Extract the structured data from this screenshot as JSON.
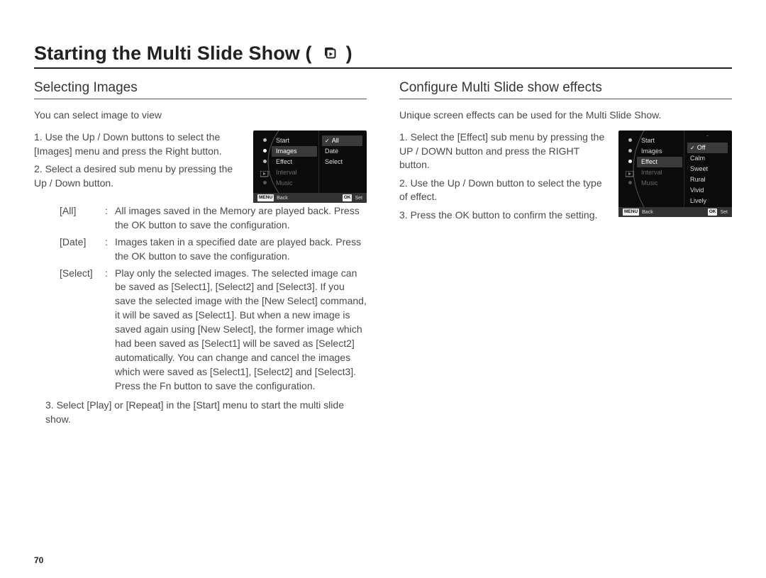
{
  "title": {
    "text_before": "Starting the Multi Slide Show (",
    "text_after": ")"
  },
  "page_number": "70",
  "left": {
    "heading": "Selecting Images",
    "lead": "You can select image to view",
    "step1": "1. Use the Up / Down buttons to select the [Images] menu and press the Right button.",
    "step2": "2. Select a desired sub menu by pressing the Up / Down button.",
    "defs": {
      "all_label": "[All]",
      "all_desc": "All images saved in the Memory are played back. Press the OK button to save the configuration.",
      "date_label": "[Date]",
      "date_desc": "Images taken in a specified date are played back. Press the OK button to save the configuration.",
      "select_label": "[Select]",
      "select_desc": "Play only the selected images. The selected image can be saved as [Select1], [Select2] and [Select3]. If you save the selected image with the [New Select] command, it will be saved as [Select1]. But when a new image is saved again using [New Select], the former image which had been saved as [Select1] will be saved as [Select2] automatically. You can change and cancel the images which were saved as [Select1], [Select2] and [Select3]. Press the Fn button to save the configuration."
    },
    "step3": "3. Select [Play] or [Repeat] in the [Start] menu to start the multi slide show.",
    "screen": {
      "menu": [
        "Start",
        "Images",
        "Effect",
        "Interval",
        "Music"
      ],
      "options": [
        "All",
        "Date",
        "Select"
      ],
      "highlight_menu_index": 1,
      "highlight_option_index": 0,
      "footer_back_label": "Back",
      "footer_back_badge": "MENU",
      "footer_set_label": "Set",
      "footer_set_badge": "OK"
    }
  },
  "right": {
    "heading": "Configure Multi Slide show effects",
    "lead": "Unique screen effects can be used for the Multi Slide Show.",
    "step1": "1. Select the [Effect] sub menu by pressing the UP / DOWN button and press the RIGHT button.",
    "step2": "2. Use the Up / Down button to select the type of effect.",
    "step3": "3. Press the OK button to confirm the setting.",
    "screen": {
      "menu": [
        "Start",
        "Images",
        "Effect",
        "Interval",
        "Music"
      ],
      "options": [
        "Off",
        "Calm",
        "Sweet",
        "Rural",
        "Vivid",
        "Lively"
      ],
      "highlight_menu_index": 2,
      "highlight_option_index": 0,
      "footer_back_label": "Back",
      "footer_back_badge": "MENU",
      "footer_set_label": "Set",
      "footer_set_badge": "OK"
    }
  }
}
